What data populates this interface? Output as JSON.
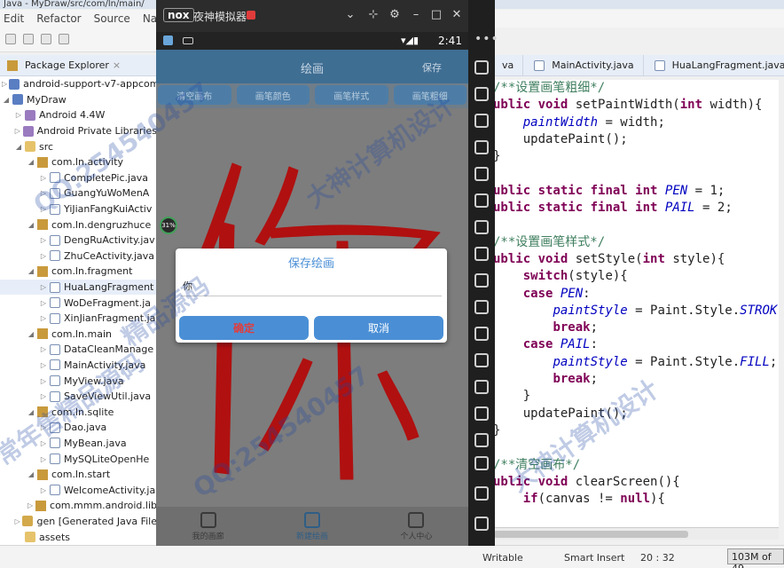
{
  "eclipse": {
    "title": "Java - MyDraw/src/com/ln/main/",
    "menu": [
      "Edit",
      "Refactor",
      "Source",
      "Nav"
    ],
    "package_explorer": {
      "tab_label": "Package Explorer",
      "items": [
        {
          "label": "android-support-v7-appcom",
          "level": 0,
          "icon": "project-icon",
          "expanded": false
        },
        {
          "label": "MyDraw",
          "level": 0,
          "icon": "project-icon",
          "expanded": true
        },
        {
          "label": "Android 4.4W",
          "level": 1,
          "icon": "lib-icon",
          "expanded": false
        },
        {
          "label": "Android Private Libraries",
          "level": 1,
          "icon": "lib-icon",
          "expanded": false
        },
        {
          "label": "src",
          "level": 1,
          "icon": "folder-icon",
          "expanded": true
        },
        {
          "label": "com.ln.activity",
          "level": 2,
          "icon": "package-icon",
          "expanded": true
        },
        {
          "label": "CompletePic.java",
          "level": 3,
          "icon": "java-file-icon",
          "expanded": false
        },
        {
          "label": "GuangYuWoMenA",
          "level": 3,
          "icon": "java-file-icon",
          "expanded": false
        },
        {
          "label": "YiJianFangKuiActiv",
          "level": 3,
          "icon": "java-file-icon",
          "expanded": false
        },
        {
          "label": "com.ln.dengruzhuce",
          "level": 2,
          "icon": "package-icon",
          "expanded": true
        },
        {
          "label": "DengRuActivity.jav",
          "level": 3,
          "icon": "java-file-icon",
          "expanded": false
        },
        {
          "label": "ZhuCeActivity.java",
          "level": 3,
          "icon": "java-file-icon",
          "expanded": false
        },
        {
          "label": "com.ln.fragment",
          "level": 2,
          "icon": "package-icon",
          "expanded": true
        },
        {
          "label": "HuaLangFragment",
          "level": 3,
          "icon": "java-file-icon",
          "expanded": false,
          "selected": true
        },
        {
          "label": "WoDeFragment.ja",
          "level": 3,
          "icon": "java-file-icon",
          "expanded": false
        },
        {
          "label": "XinJianFragment.ja",
          "level": 3,
          "icon": "java-file-icon",
          "expanded": false
        },
        {
          "label": "com.ln.main",
          "level": 2,
          "icon": "package-icon",
          "expanded": true
        },
        {
          "label": "DataCleanManage",
          "level": 3,
          "icon": "java-file-icon",
          "expanded": false
        },
        {
          "label": "MainActivity.java",
          "level": 3,
          "icon": "java-file-icon",
          "expanded": false
        },
        {
          "label": "MyView.java",
          "level": 3,
          "icon": "java-file-icon",
          "expanded": false
        },
        {
          "label": "SaveViewUtil.java",
          "level": 3,
          "icon": "java-file-icon",
          "expanded": false
        },
        {
          "label": "com.ln.sqlite",
          "level": 2,
          "icon": "package-icon",
          "expanded": true
        },
        {
          "label": "Dao.java",
          "level": 3,
          "icon": "java-file-icon",
          "expanded": false
        },
        {
          "label": "MyBean.java",
          "level": 3,
          "icon": "java-file-icon",
          "expanded": false
        },
        {
          "label": "MySQLiteOpenHe",
          "level": 3,
          "icon": "java-file-icon",
          "expanded": false
        },
        {
          "label": "com.ln.start",
          "level": 2,
          "icon": "package-icon",
          "expanded": true
        },
        {
          "label": "WelcomeActivity.ja",
          "level": 3,
          "icon": "java-file-icon",
          "expanded": false
        },
        {
          "label": "com.mmm.android.lib",
          "level": 2,
          "icon": "package-icon",
          "expanded": false
        },
        {
          "label": "gen [Generated Java File",
          "level": 1,
          "icon": "gen-folder-icon",
          "expanded": false
        },
        {
          "label": "assets",
          "level": 1,
          "icon": "folder-icon",
          "expanded": null
        }
      ]
    },
    "editor_tabs": [
      {
        "label": "va",
        "closable": false
      },
      {
        "label": "MainActivity.java",
        "closable": false
      },
      {
        "label": "HuaLangFragment.java",
        "closable": false
      }
    ],
    "code_lines": [
      [
        {
          "t": "/**设置画笔粗细*/",
          "c": "cm"
        }
      ],
      [
        {
          "t": "ublic ",
          "c": "kw"
        },
        {
          "t": "void ",
          "c": "kw"
        },
        {
          "t": "setPaintWidth(",
          "c": ""
        },
        {
          "t": "int ",
          "c": "kw"
        },
        {
          "t": "width){",
          "c": ""
        }
      ],
      [
        {
          "t": "    ",
          "c": ""
        },
        {
          "t": "paintWidth",
          "c": "fld"
        },
        {
          "t": " = width;",
          "c": ""
        }
      ],
      [
        {
          "t": "    updatePaint();",
          "c": ""
        }
      ],
      [
        {
          "t": "}",
          "c": ""
        }
      ],
      [
        {
          "t": "",
          "c": ""
        }
      ],
      [
        {
          "t": "ublic ",
          "c": "kw"
        },
        {
          "t": "static ",
          "c": "kw"
        },
        {
          "t": "final ",
          "c": "kw"
        },
        {
          "t": "int ",
          "c": "kw"
        },
        {
          "t": "PEN",
          "c": "fld"
        },
        {
          "t": " = 1;",
          "c": ""
        }
      ],
      [
        {
          "t": "ublic ",
          "c": "kw"
        },
        {
          "t": "static ",
          "c": "kw"
        },
        {
          "t": "final ",
          "c": "kw"
        },
        {
          "t": "int ",
          "c": "kw"
        },
        {
          "t": "PAIL",
          "c": "fld"
        },
        {
          "t": " = 2;",
          "c": ""
        }
      ],
      [
        {
          "t": "",
          "c": ""
        }
      ],
      [
        {
          "t": "/**设置画笔样式*/",
          "c": "cm"
        }
      ],
      [
        {
          "t": "ublic ",
          "c": "kw"
        },
        {
          "t": "void ",
          "c": "kw"
        },
        {
          "t": "setStyle(",
          "c": ""
        },
        {
          "t": "int ",
          "c": "kw"
        },
        {
          "t": "style){",
          "c": ""
        }
      ],
      [
        {
          "t": "    ",
          "c": ""
        },
        {
          "t": "switch",
          "c": "kw"
        },
        {
          "t": "(style){",
          "c": ""
        }
      ],
      [
        {
          "t": "    ",
          "c": ""
        },
        {
          "t": "case ",
          "c": "kw"
        },
        {
          "t": "PEN",
          "c": "fld"
        },
        {
          "t": ":",
          "c": ""
        }
      ],
      [
        {
          "t": "        ",
          "c": ""
        },
        {
          "t": "paintStyle",
          "c": "fld"
        },
        {
          "t": " = Paint.Style.",
          "c": ""
        },
        {
          "t": "STROK",
          "c": "fld"
        }
      ],
      [
        {
          "t": "        ",
          "c": ""
        },
        {
          "t": "break",
          "c": "kw"
        },
        {
          "t": ";",
          "c": ""
        }
      ],
      [
        {
          "t": "    ",
          "c": ""
        },
        {
          "t": "case ",
          "c": "kw"
        },
        {
          "t": "PAIL",
          "c": "fld"
        },
        {
          "t": ":",
          "c": ""
        }
      ],
      [
        {
          "t": "        ",
          "c": ""
        },
        {
          "t": "paintStyle",
          "c": "fld"
        },
        {
          "t": " = Paint.Style.",
          "c": ""
        },
        {
          "t": "FILL",
          "c": "fld"
        },
        {
          "t": ";",
          "c": ""
        }
      ],
      [
        {
          "t": "        ",
          "c": ""
        },
        {
          "t": "break",
          "c": "kw"
        },
        {
          "t": ";",
          "c": ""
        }
      ],
      [
        {
          "t": "    }",
          "c": ""
        }
      ],
      [
        {
          "t": "    updatePaint();",
          "c": ""
        }
      ],
      [
        {
          "t": "}",
          "c": ""
        }
      ],
      [
        {
          "t": "",
          "c": ""
        }
      ],
      [
        {
          "t": "/**清空画布*/",
          "c": "cm"
        }
      ],
      [
        {
          "t": "ublic ",
          "c": "kw"
        },
        {
          "t": "void ",
          "c": "kw"
        },
        {
          "t": "clearScreen(){",
          "c": ""
        }
      ],
      [
        {
          "t": "    ",
          "c": ""
        },
        {
          "t": "if",
          "c": "kw"
        },
        {
          "t": "(canvas != ",
          "c": ""
        },
        {
          "t": "null",
          "c": "kw"
        },
        {
          "t": "){",
          "c": ""
        }
      ]
    ],
    "status": {
      "writable": "Writable",
      "insert_mode": "Smart Insert",
      "position": "20 : 32",
      "heap": "103M of 49"
    }
  },
  "nox": {
    "logo": "nox",
    "title": "夜神模拟器",
    "android": {
      "time": "2:41",
      "app_title": "绘画",
      "save_action": "保存",
      "tools": [
        "清空画布",
        "画笔颜色",
        "画笔样式",
        "画笔粗细"
      ],
      "progress_chip": "31%",
      "dialog": {
        "title": "保存绘画",
        "input_value": "你",
        "confirm": "确定",
        "cancel": "取消"
      },
      "bottom_nav": [
        {
          "label": "我的画廊",
          "icon": "home-icon",
          "active": false
        },
        {
          "label": "新建绘画",
          "icon": "grid-icon",
          "active": true
        },
        {
          "label": "个人中心",
          "icon": "profile-icon",
          "active": false
        }
      ]
    }
  },
  "watermarks": [
    "QQ:254540457",
    "大神计算机设计",
    "精品源码",
    "常年售精品源码",
    "QQ:254540457",
    "大神计算机设计"
  ],
  "colors": {
    "app_header": "#3f6e93",
    "dialog_button": "#4a8fd6",
    "confirm_text": "#e23c3c",
    "stroke": "#b01010",
    "keyword": "#7f0055",
    "comment": "#3f7f5f",
    "field": "#0000c0"
  }
}
